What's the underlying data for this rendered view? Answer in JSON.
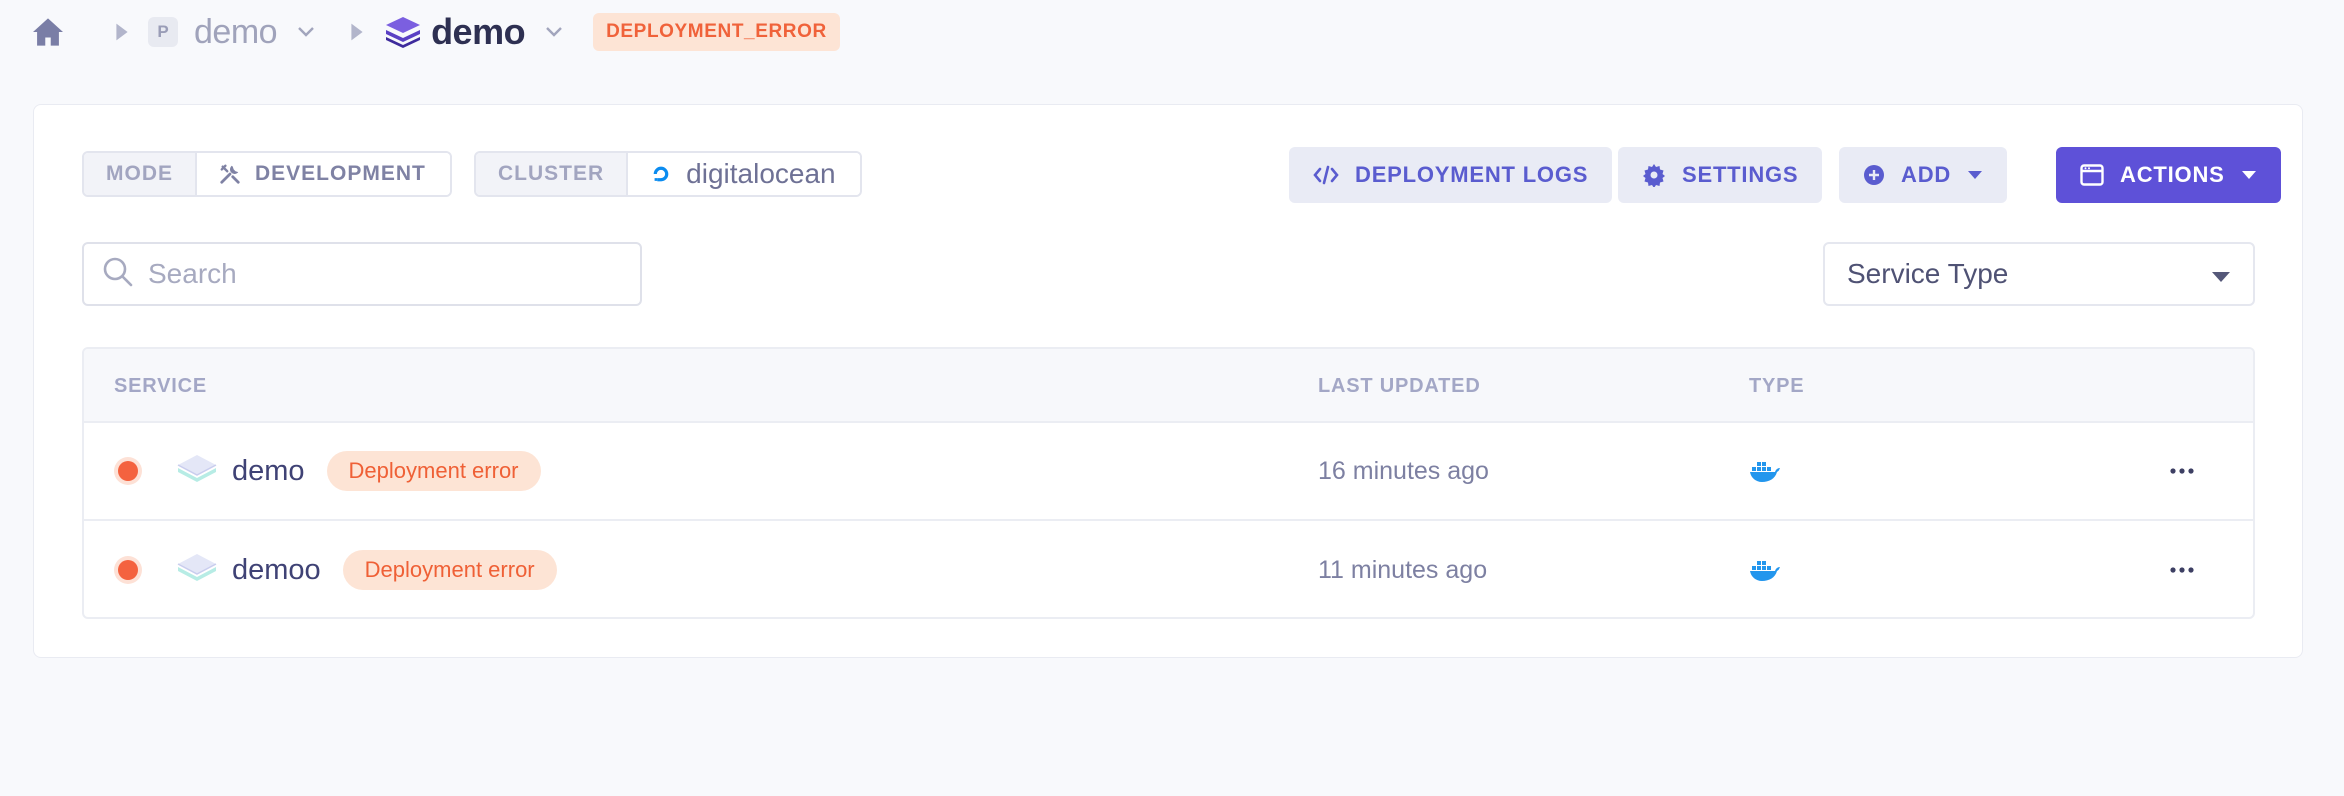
{
  "breadcrumb": {
    "project_initial": "P",
    "project_name": "demo",
    "environment_name": "demo",
    "status_badge": "DEPLOYMENT_ERROR"
  },
  "filters": {
    "mode_label": "MODE",
    "mode_value": "DEVELOPMENT",
    "cluster_label": "CLUSTER",
    "cluster_value": "digitalocean"
  },
  "toolbar": {
    "deployment_logs_label": "DEPLOYMENT LOGS",
    "settings_label": "SETTINGS",
    "add_label": "ADD",
    "actions_label": "ACTIONS"
  },
  "search": {
    "placeholder": "Search"
  },
  "service_type_select": {
    "selected": "Service Type"
  },
  "table": {
    "headers": {
      "service": "SERVICE",
      "last_updated": "LAST UPDATED",
      "type": "TYPE"
    },
    "rows": [
      {
        "name": "demo",
        "status": "Deployment error",
        "last_updated": "16 minutes ago",
        "type_icon": "docker-icon"
      },
      {
        "name": "demoo",
        "status": "Deployment error",
        "last_updated": "11 minutes ago",
        "type_icon": "docker-icon"
      }
    ]
  },
  "colors": {
    "accent": "#5e51d8",
    "error": "#f4623f",
    "error_bg": "#fde4d5",
    "docker": "#2396ed"
  }
}
